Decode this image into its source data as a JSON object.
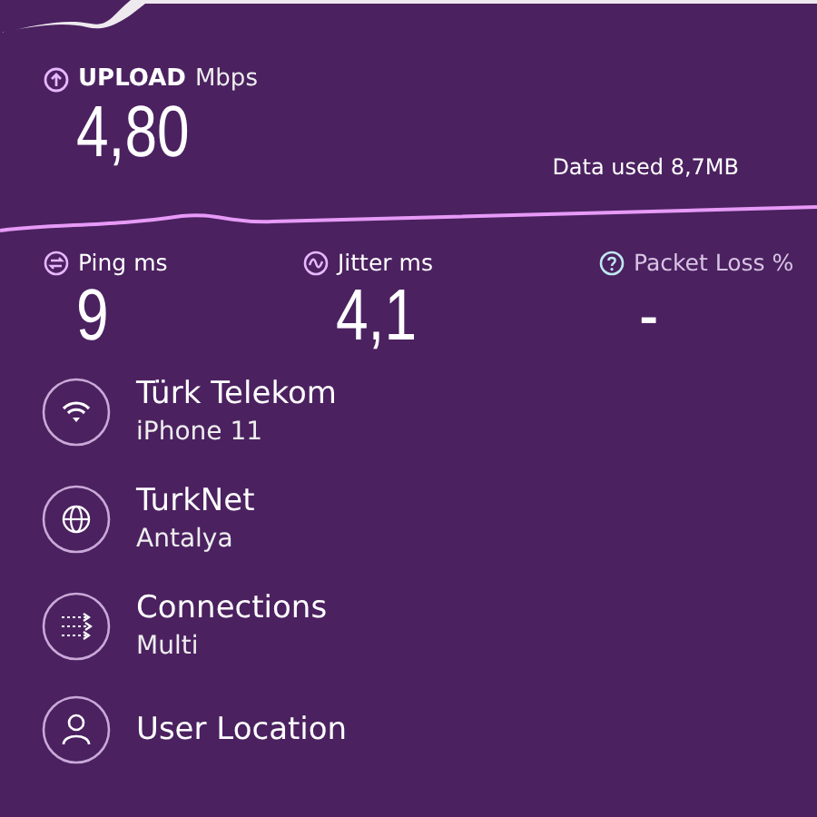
{
  "upload": {
    "label": "UPLOAD",
    "unit": "Mbps",
    "value": "4,80",
    "data_used": "Data used 8,7MB"
  },
  "metrics": [
    {
      "label": "Ping",
      "unit": "ms",
      "value": "9"
    },
    {
      "label": "Jitter",
      "unit": "ms",
      "value": "4,1"
    },
    {
      "label": "Packet Loss",
      "unit": "%",
      "value": "-"
    }
  ],
  "details": [
    {
      "title": "Türk Telekom",
      "subtitle": "iPhone 11"
    },
    {
      "title": "TurkNet",
      "subtitle": "Antalya"
    },
    {
      "title": "Connections",
      "subtitle": "Multi"
    },
    {
      "title": "User Location"
    }
  ]
}
